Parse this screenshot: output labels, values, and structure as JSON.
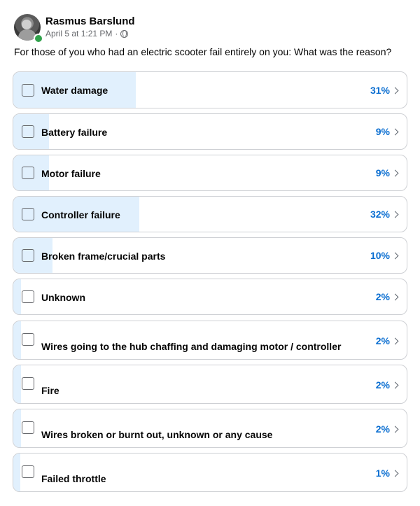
{
  "post": {
    "author": "Rasmus Barslund",
    "date": "April 5 at 1:21 PM",
    "separator": "·",
    "audience_icon": "globe-icon",
    "question": "For those of you who had an electric scooter fail entirely on you: What was the reason?"
  },
  "poll": {
    "options": [
      {
        "label": "Water damage",
        "percent_label": "31%",
        "percent": 31
      },
      {
        "label": "Battery failure",
        "percent_label": "9%",
        "percent": 9
      },
      {
        "label": "Motor failure",
        "percent_label": "9%",
        "percent": 9
      },
      {
        "label": "Controller failure",
        "percent_label": "32%",
        "percent": 32
      },
      {
        "label": "Broken frame/crucial parts",
        "percent_label": "10%",
        "percent": 10
      },
      {
        "label": "Unknown",
        "percent_label": "2%",
        "percent": 2
      },
      {
        "label": "Wires going to the hub chaffing and damaging motor / controller",
        "percent_label": "2%",
        "percent": 2
      },
      {
        "label": "Fire",
        "percent_label": "2%",
        "percent": 2
      },
      {
        "label": "Wires broken or burnt out, unknown or any cause",
        "percent_label": "2%",
        "percent": 2
      },
      {
        "label": "Failed throttle",
        "percent_label": "1%",
        "percent": 1
      }
    ]
  },
  "colors": {
    "bar_fill": "#e1f0fd",
    "percent_text": "#0a6ed1",
    "online": "#31a24c"
  }
}
